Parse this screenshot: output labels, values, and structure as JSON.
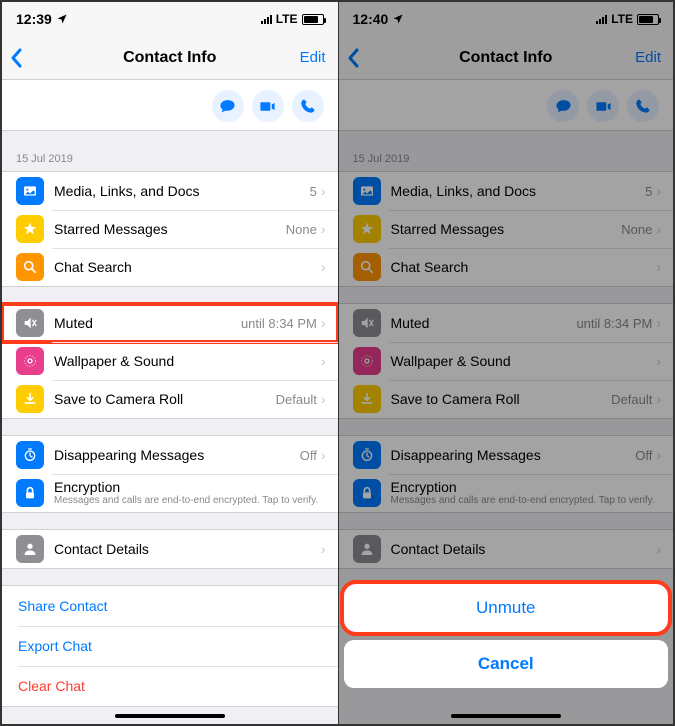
{
  "left": {
    "status": {
      "time": "12:39",
      "net": "LTE"
    },
    "nav": {
      "title": "Contact Info",
      "edit": "Edit"
    },
    "date": "15 Jul 2019",
    "g1": {
      "media": {
        "label": "Media, Links, and Docs",
        "value": "5"
      },
      "starred": {
        "label": "Starred Messages",
        "value": "None"
      },
      "search": {
        "label": "Chat Search"
      }
    },
    "g2": {
      "muted": {
        "label": "Muted",
        "value": "until 8:34 PM"
      },
      "wallpaper": {
        "label": "Wallpaper & Sound"
      },
      "save": {
        "label": "Save to Camera Roll",
        "value": "Default"
      }
    },
    "g3": {
      "disappearing": {
        "label": "Disappearing Messages",
        "value": "Off"
      },
      "encryption": {
        "label": "Encryption",
        "sub": "Messages and calls are end-to-end encrypted. Tap to verify."
      }
    },
    "g4": {
      "details": {
        "label": "Contact Details"
      }
    },
    "actions": {
      "share": "Share Contact",
      "export": "Export Chat",
      "clear": "Clear Chat"
    }
  },
  "right": {
    "status": {
      "time": "12:40",
      "net": "LTE"
    },
    "sheet": {
      "unmute": "Unmute",
      "cancel": "Cancel"
    }
  },
  "colors": {
    "media": "#007aff",
    "star": "#ffcc00",
    "search": "#ff9500",
    "muted": "#8e8e93",
    "wallpaper": "#e83e8c",
    "save": "#ffcc00",
    "disappearing": "#007aff",
    "encryption": "#007aff",
    "details": "#8e8e93"
  }
}
